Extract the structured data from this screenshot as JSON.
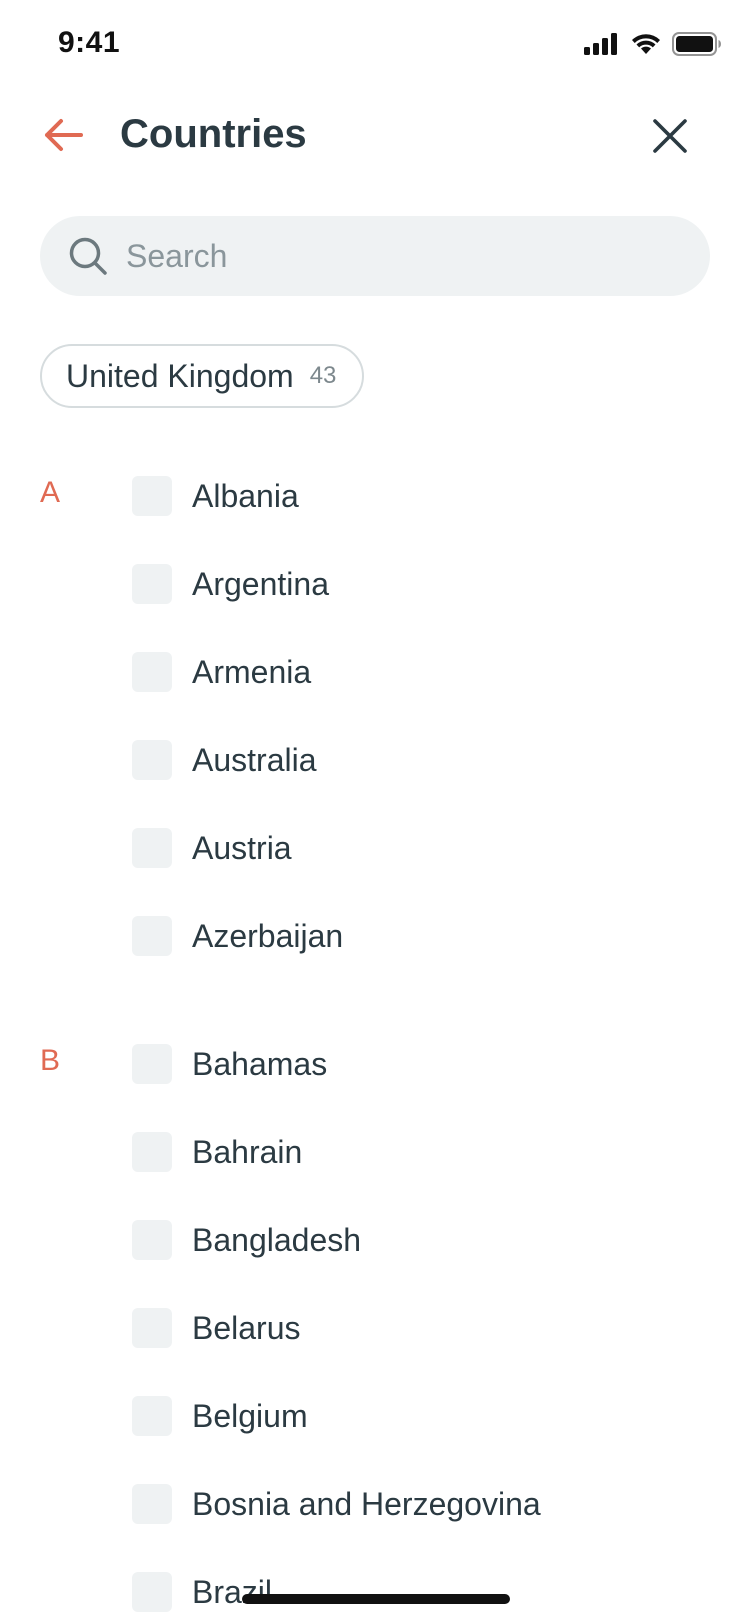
{
  "status_bar": {
    "time": "9:41"
  },
  "header": {
    "title": "Countries"
  },
  "search": {
    "placeholder": "Search",
    "value": ""
  },
  "selected_chip": {
    "label": "United Kingdom",
    "count": "43"
  },
  "sections": [
    {
      "letter": "A",
      "items": [
        "Albania",
        "Argentina",
        "Armenia",
        "Australia",
        "Austria",
        "Azerbaijan"
      ]
    },
    {
      "letter": "B",
      "items": [
        "Bahamas",
        "Bahrain",
        "Bangladesh",
        "Belarus",
        "Belgium",
        "Bosnia and Herzegovina",
        "Brazil"
      ]
    }
  ],
  "colors": {
    "accent": "#e06a53",
    "text": "#2b3a42",
    "field_bg": "#eff2f3"
  }
}
